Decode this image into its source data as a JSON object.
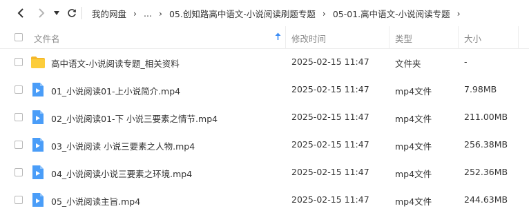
{
  "breadcrumb": [
    "我的网盘",
    "...",
    "05.创知路高中语文-小说阅读刷题专题",
    "05-01.高中语文-小说阅读专题"
  ],
  "columns": {
    "name": "文件名",
    "modified": "修改时间",
    "type": "类型",
    "size": "大小"
  },
  "rows": [
    {
      "icon": "folder-icon",
      "name": "高中语文-小说阅读专题_相关资料",
      "modified": "2025-02-15 11:47",
      "type": "文件夹",
      "size": "-"
    },
    {
      "icon": "video-file-icon",
      "name": "01_小说阅读01-上小说简介.mp4",
      "modified": "2025-02-15 11:47",
      "type": "mp4文件",
      "size": "7.98MB"
    },
    {
      "icon": "video-file-icon",
      "name": "02_小说阅读01-下 小说三要素之情节.mp4",
      "modified": "2025-02-15 11:47",
      "type": "mp4文件",
      "size": "211.00MB"
    },
    {
      "icon": "video-file-icon",
      "name": "03_小说阅读 小说三要素之人物.mp4",
      "modified": "2025-02-15 11:47",
      "type": "mp4文件",
      "size": "256.38MB"
    },
    {
      "icon": "video-file-icon",
      "name": "04_小说阅读小说三要素之环境.mp4",
      "modified": "2025-02-15 11:47",
      "type": "mp4文件",
      "size": "252.36MB"
    },
    {
      "icon": "video-file-icon",
      "name": "05_小说阅读主旨.mp4",
      "modified": "2025-02-15 11:47",
      "type": "mp4文件",
      "size": "244.63MB"
    }
  ],
  "colors": {
    "folder": "#f8c62f",
    "video": "#4a9df8",
    "sort_arrow": "#3b8cf5"
  }
}
